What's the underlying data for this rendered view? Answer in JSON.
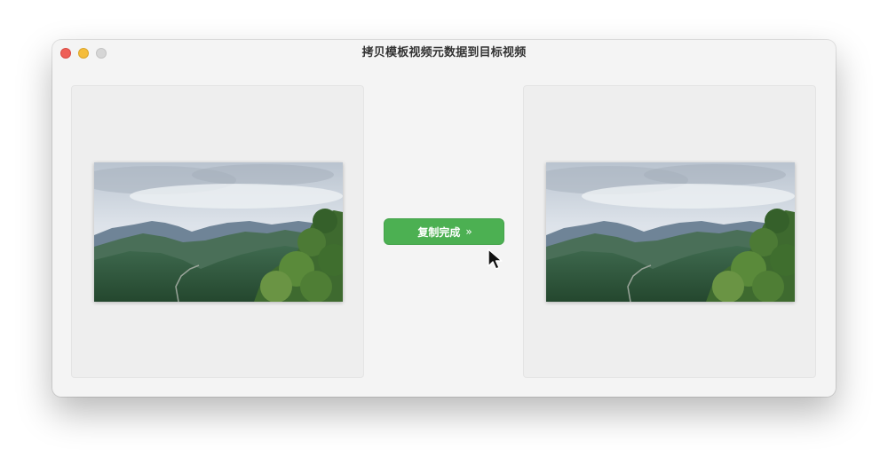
{
  "window": {
    "title": "拷贝模板视频元数据到目标视频"
  },
  "main": {
    "source_video_label": "source-video-thumbnail",
    "target_video_label": "target-video-thumbnail",
    "copy_button": {
      "label": "复制完成",
      "icon": "double-chevron-right-icon",
      "glyph": "»",
      "color": "#4cb052"
    }
  },
  "colors": {
    "window_bg": "#f4f4f4",
    "panel_bg": "#eeeeee",
    "close": "#ee5f57",
    "minimize": "#f5bd3b",
    "maximize_disabled": "#d6d6d6"
  }
}
